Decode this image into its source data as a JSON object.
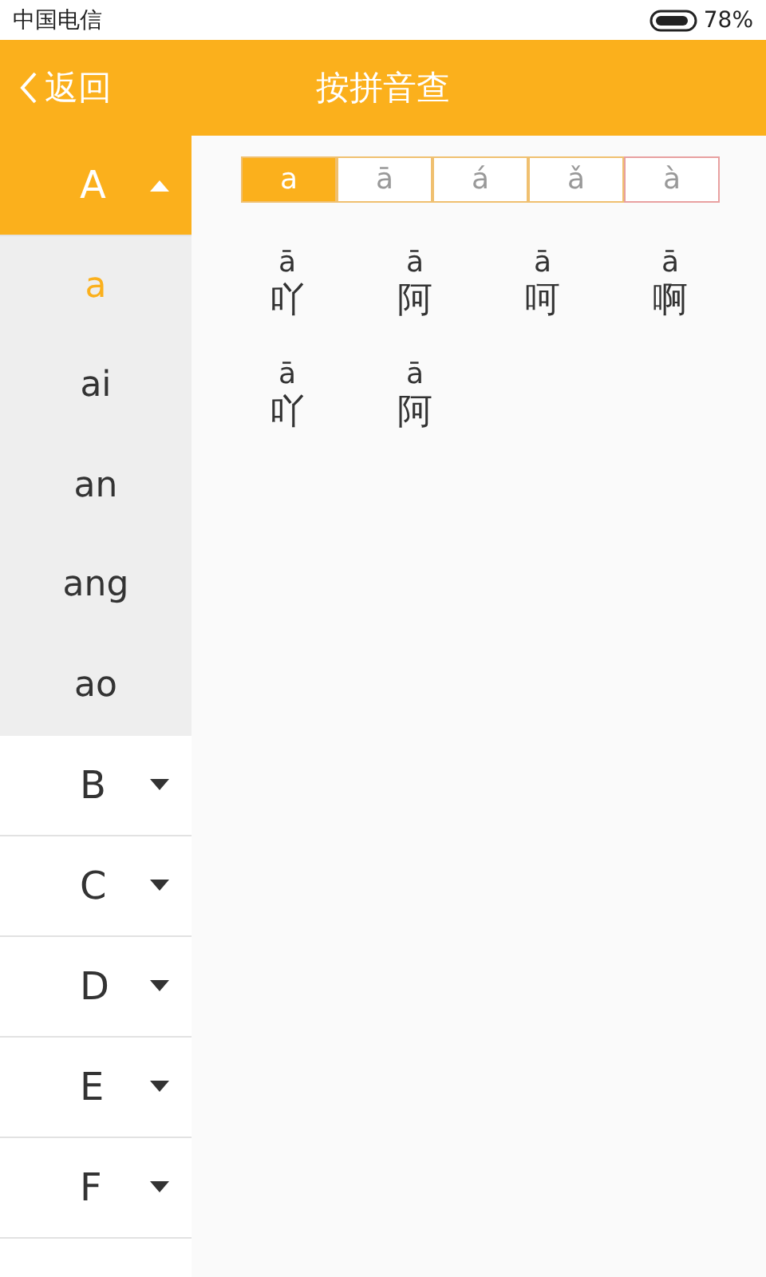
{
  "status_bar": {
    "carrier": "中国电信",
    "battery": "78%"
  },
  "header": {
    "back": "返回",
    "title": "按拼音查"
  },
  "sidebar": {
    "groups": [
      {
        "letter": "A",
        "expanded": true,
        "children": [
          {
            "label": "a",
            "selected": true
          },
          {
            "label": "ai",
            "selected": false
          },
          {
            "label": "an",
            "selected": false
          },
          {
            "label": "ang",
            "selected": false
          },
          {
            "label": "ao",
            "selected": false
          }
        ]
      },
      {
        "letter": "B",
        "expanded": false
      },
      {
        "letter": "C",
        "expanded": false
      },
      {
        "letter": "D",
        "expanded": false
      },
      {
        "letter": "E",
        "expanded": false
      },
      {
        "letter": "F",
        "expanded": false
      }
    ]
  },
  "tones": [
    {
      "label": "a",
      "selected": true,
      "color": "#f0c070"
    },
    {
      "label": "ā",
      "selected": false,
      "color": "#f0c070"
    },
    {
      "label": "á",
      "selected": false,
      "color": "#f0c070"
    },
    {
      "label": "ǎ",
      "selected": false,
      "color": "#f0c070"
    },
    {
      "label": "à",
      "selected": false,
      "color": "#e8a0a0"
    }
  ],
  "characters": [
    {
      "pinyin": "ā",
      "char": "吖"
    },
    {
      "pinyin": "ā",
      "char": "阿"
    },
    {
      "pinyin": "ā",
      "char": "呵"
    },
    {
      "pinyin": "ā",
      "char": "啊"
    },
    {
      "pinyin": "ā",
      "char": "吖"
    },
    {
      "pinyin": "ā",
      "char": "阿"
    }
  ]
}
